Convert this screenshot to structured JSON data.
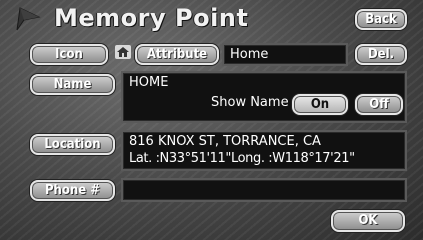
{
  "header": {
    "title": "Memory Point",
    "back_label": "Back"
  },
  "icon_row": {
    "icon_label": "Icon",
    "attribute_label": "Attribute",
    "attribute_value": "Home",
    "delete_label": "Del."
  },
  "name_section": {
    "button_label": "Name",
    "value": "HOME",
    "show_name_label": "Show Name",
    "on_label": "On",
    "off_label": "Off",
    "show_name_state": "On"
  },
  "location_section": {
    "button_label": "Location",
    "address": "816 KNOX ST, TORRANCE, CA",
    "coordinates": "Lat. :N33°51'11\"Long. :W118°17'21\""
  },
  "phone_section": {
    "button_label": "Phone #",
    "value": ""
  },
  "footer": {
    "ok_label": "OK"
  },
  "colors": {
    "button_face": "#a8a8a8",
    "field_bg": "#111111",
    "text": "#ffffff"
  }
}
